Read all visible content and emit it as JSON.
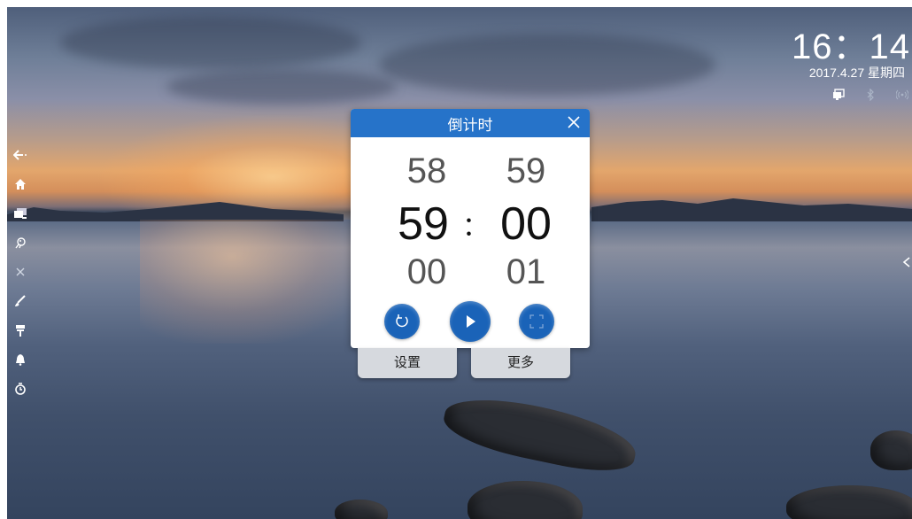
{
  "statusbar": {
    "time": "16：14",
    "date": "2017.4.27 星期四",
    "icons": [
      "screen-share-icon",
      "bluetooth-icon",
      "wireless-icon"
    ]
  },
  "sidebar": {
    "items": [
      "back-icon",
      "home-icon",
      "windows-icon",
      "pet-icon",
      "close-icon",
      "brush-icon",
      "paint-roller-icon",
      "bell-icon",
      "timer-icon"
    ]
  },
  "countdown": {
    "title": "倒计时",
    "minutes_prev": "58",
    "minutes": "59",
    "minutes_next": "00",
    "seconds_prev": "59",
    "seconds": "00",
    "seconds_next": "01",
    "separator": "：",
    "colors": {
      "header": "#2673c9",
      "button": "#1a63b8"
    }
  },
  "tabs": {
    "settings_label": "设置",
    "more_label": "更多"
  }
}
